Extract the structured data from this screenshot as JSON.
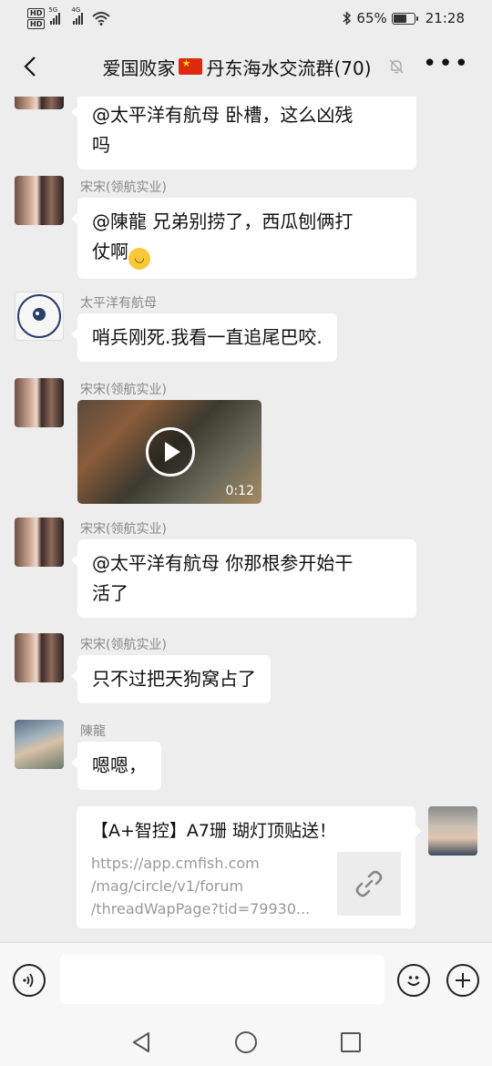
{
  "status_bar": {
    "hd1": "HD",
    "hd2": "HD",
    "net1": "5G",
    "net2": "4G",
    "battery_percent": "65%",
    "battery_level": 0.65,
    "time": "21:28"
  },
  "header": {
    "title_before": "爱国败家",
    "title_after": "丹东海水交流群(70)",
    "flag_icon": "china-flag-emoji",
    "mute_icon": "bell-off-icon",
    "more_label": "•••"
  },
  "messages": [
    {
      "sender": "",
      "text_line1": "@太平洋有航母  卧槽，这么凶残",
      "text_line2": "吗"
    },
    {
      "sender": "宋宋(领航实业)",
      "text_line1": "@陳龍  兄弟别捞了，西瓜刨俩打",
      "text_line2": "仗啊"
    },
    {
      "sender": "太平洋有航母",
      "text": "哨兵刚死.我看一直追尾巴咬."
    },
    {
      "sender": "宋宋(领航实业)",
      "video_duration": "0:12"
    },
    {
      "sender": "宋宋(领航实业)",
      "text_line1": "@太平洋有航母  你那根参开始干",
      "text_line2": "活了"
    },
    {
      "sender": "宋宋(领航实业)",
      "text": "只不过把天狗窝占了"
    },
    {
      "sender": "陳龍",
      "text": "嗯嗯，"
    },
    {
      "link_title": "【A+智控】A7珊 瑚灯顶贴送！",
      "link_url_line1": "https://app.cmfish.com",
      "link_url_line2": "/mag/circle/v1/forum",
      "link_url_line3": "/threadWapPage?tid=79930..."
    }
  ],
  "input_bar": {
    "voice_icon": "voice-icon",
    "emoji_icon": "emoji-icon",
    "plus_icon": "plus-icon",
    "text_value": ""
  },
  "nav_bar": {
    "back_icon": "triangle-back-icon",
    "home_icon": "circle-home-icon",
    "recents_icon": "square-recents-icon"
  }
}
